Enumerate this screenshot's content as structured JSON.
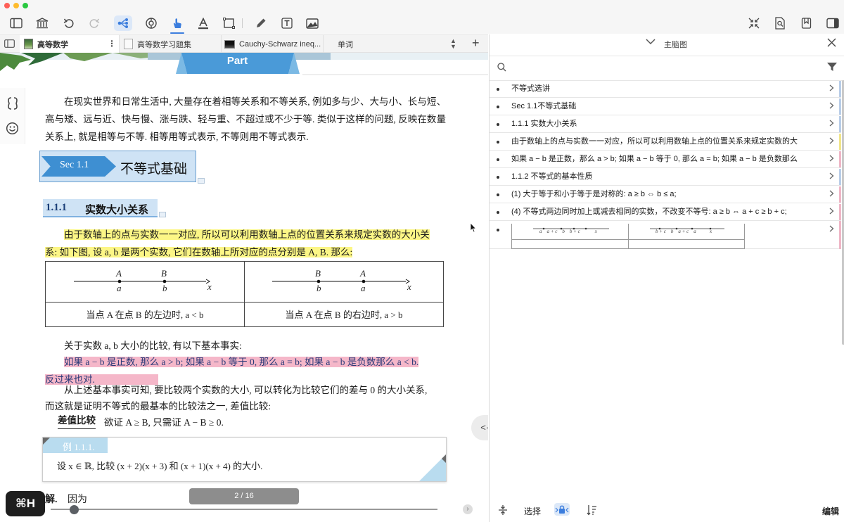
{
  "window": {
    "traffic_lights": [
      "#fe5f57",
      "#febc2e",
      "#28c840"
    ]
  },
  "toolbar": {
    "left_icons": [
      "sidebar-toggle-icon",
      "library-icon",
      "undo-icon",
      "redo-icon",
      "mindmap-icon",
      "sync-icon",
      "hand-tool-icon",
      "text-highlight-icon",
      "rectangle-select-icon",
      "pen-icon",
      "text-box-icon",
      "image-icon"
    ],
    "right_icons": [
      "collapse-icon",
      "document-search-icon",
      "bookmark-icon",
      "sidebar-right-icon"
    ]
  },
  "tabs": [
    {
      "label": "高等数学",
      "active": true
    },
    {
      "label": "高等数学习题集",
      "active": false
    },
    {
      "label": "Cauchy-Schwarz ineq...",
      "active": false
    },
    {
      "label": "单词",
      "active": false
    }
  ],
  "doc": {
    "part_label": "Part",
    "intro": "在现实世界和日常生活中, 大量存在着相等关系和不等关系, 例如多与少、大与小、长与短、高与矮、远与近、快与慢、涨与跌、轻与重、不超过或不少于等. 类似于这样的问题, 反映在数量关系上, 就是相等与不等. 相等用等式表示, 不等则用不等式表示.",
    "section_label": "Sec 1.1",
    "section_title": "不等式基础",
    "sub_number": "1.1.1",
    "sub_title": "实数大小关系",
    "yellow_text_1": "由于数轴上的点与实数一一对应, 所以可以利用数轴上点的位置关系来规定实数的大小关",
    "yellow_text_2": "系: 如下图, 设 a, b 是两个实数, 它们在数轴上所对应的点分别是 A, B. 那么:",
    "fig_left": {
      "upper": [
        "A",
        "B"
      ],
      "lower": [
        "a",
        "b"
      ],
      "axis": "x",
      "caption": "当点 A 在点 B 的左边时, a < b"
    },
    "fig_right": {
      "upper": [
        "B",
        "A"
      ],
      "lower": [
        "b",
        "a"
      ],
      "axis": "x",
      "caption": "当点 A 在点 B 的右边时, a > b"
    },
    "facts_intro": "关于实数 a, b 大小的比较, 有以下基本事实:",
    "pink_text_1": "如果 a − b 是正数, 那么 a > b; 如果 a − b 等于 0, 那么 a = b; 如果 a − b 是负数那么 a < b.",
    "pink_text_2": "反过来也对.",
    "para2_1": "从上述基本事实可知, 要比较两个实数的大小, 可以转化为比较它们的差与 0 的大小关系,",
    "para2_2": "而这就是证明不等式的最基本的比较法之一, 差值比较:",
    "diff_label": "差值比较",
    "diff_text": "欲证 A ≥ B, 只需证 A − B ≥ 0.",
    "example_label": "例 1.1.1.",
    "example_text": "设 x ∈ ℝ, 比较 (x + 2)(x + 3) 和 (x + 1)(x + 4) 的大小.",
    "solution_label": "解.",
    "solution_text": "因为",
    "page_indicator": "2 / 16",
    "slider_progress": 0.06,
    "hotkey_badge": "⌘H",
    "nav_handle": "<·>"
  },
  "panel": {
    "title": "主脑图",
    "rows": [
      {
        "text": "不等式选讲",
        "bar": "#b9cde8"
      },
      {
        "text": "Sec 1.1不等式基础",
        "bar": "#b9cde8"
      },
      {
        "text": "1.1.1 实数大小关系",
        "bar": "#b9cde8"
      },
      {
        "text": "由于数轴上的点与实数一一对应，所以可以利用数轴上点的位置关系来规定实数的大",
        "bar": "#f1e58a"
      },
      {
        "text": "如果 a − b 是正数，那么 a > b; 如果 a − b 等于 0, 那么 a = b; 如果 a − b 是负数那么",
        "bar": "#efb6c6"
      },
      {
        "text": "1.1.2 不等式的基本性质",
        "bar": "#b9cde8"
      },
      {
        "text": "(1) 大于等于和小于等于是对称的: a ≥ b ⇔ b ≤ a;",
        "bar": "#efb6c6"
      },
      {
        "text": "(4) 不等式两边同时加上或减去相同的实数，不改变不等号: a ≥ b ⇔ a + c ≥ b + c;",
        "bar": "#efb6c6"
      }
    ],
    "thumb_left": [
      "a",
      "a + c",
      "b",
      "b + c",
      "x"
    ],
    "thumb_right": [
      "b + c",
      "b",
      "a + c",
      "a",
      "x"
    ],
    "bottom": {
      "select_label": "选择",
      "edit_label": "编辑"
    }
  }
}
